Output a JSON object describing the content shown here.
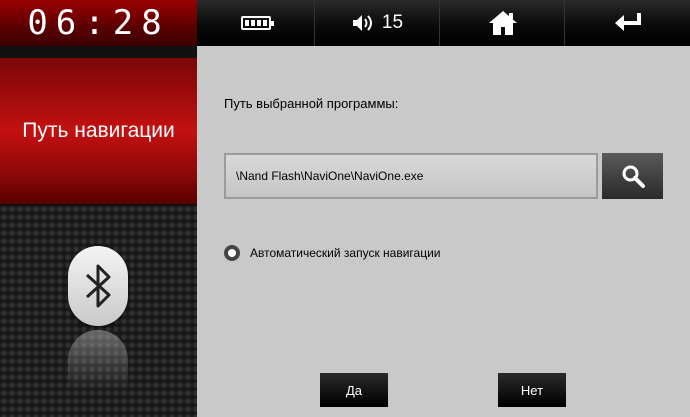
{
  "statusbar": {
    "clock": "06:28",
    "battery_icon": "battery-icon",
    "volume_icon": "speaker-icon",
    "volume_level": "15",
    "home_icon": "home-icon",
    "back_icon": "return-arrow-icon"
  },
  "sidebar": {
    "active_item": "Путь навигации",
    "bluetooth_icon": "bluetooth-icon"
  },
  "main": {
    "path_label": "Путь выбранной программы:",
    "path_value": "\\Nand Flash\\NaviOne\\NaviOne.exe",
    "search_icon": "search-icon",
    "auto_start_label": "Автоматический запуск навигации",
    "auto_start_checked": true,
    "yes_label": "Да",
    "no_label": "Нет"
  },
  "colors": {
    "accent_red": "#c41010",
    "panel_gray": "#c9c9c9",
    "button_black": "#000000"
  }
}
